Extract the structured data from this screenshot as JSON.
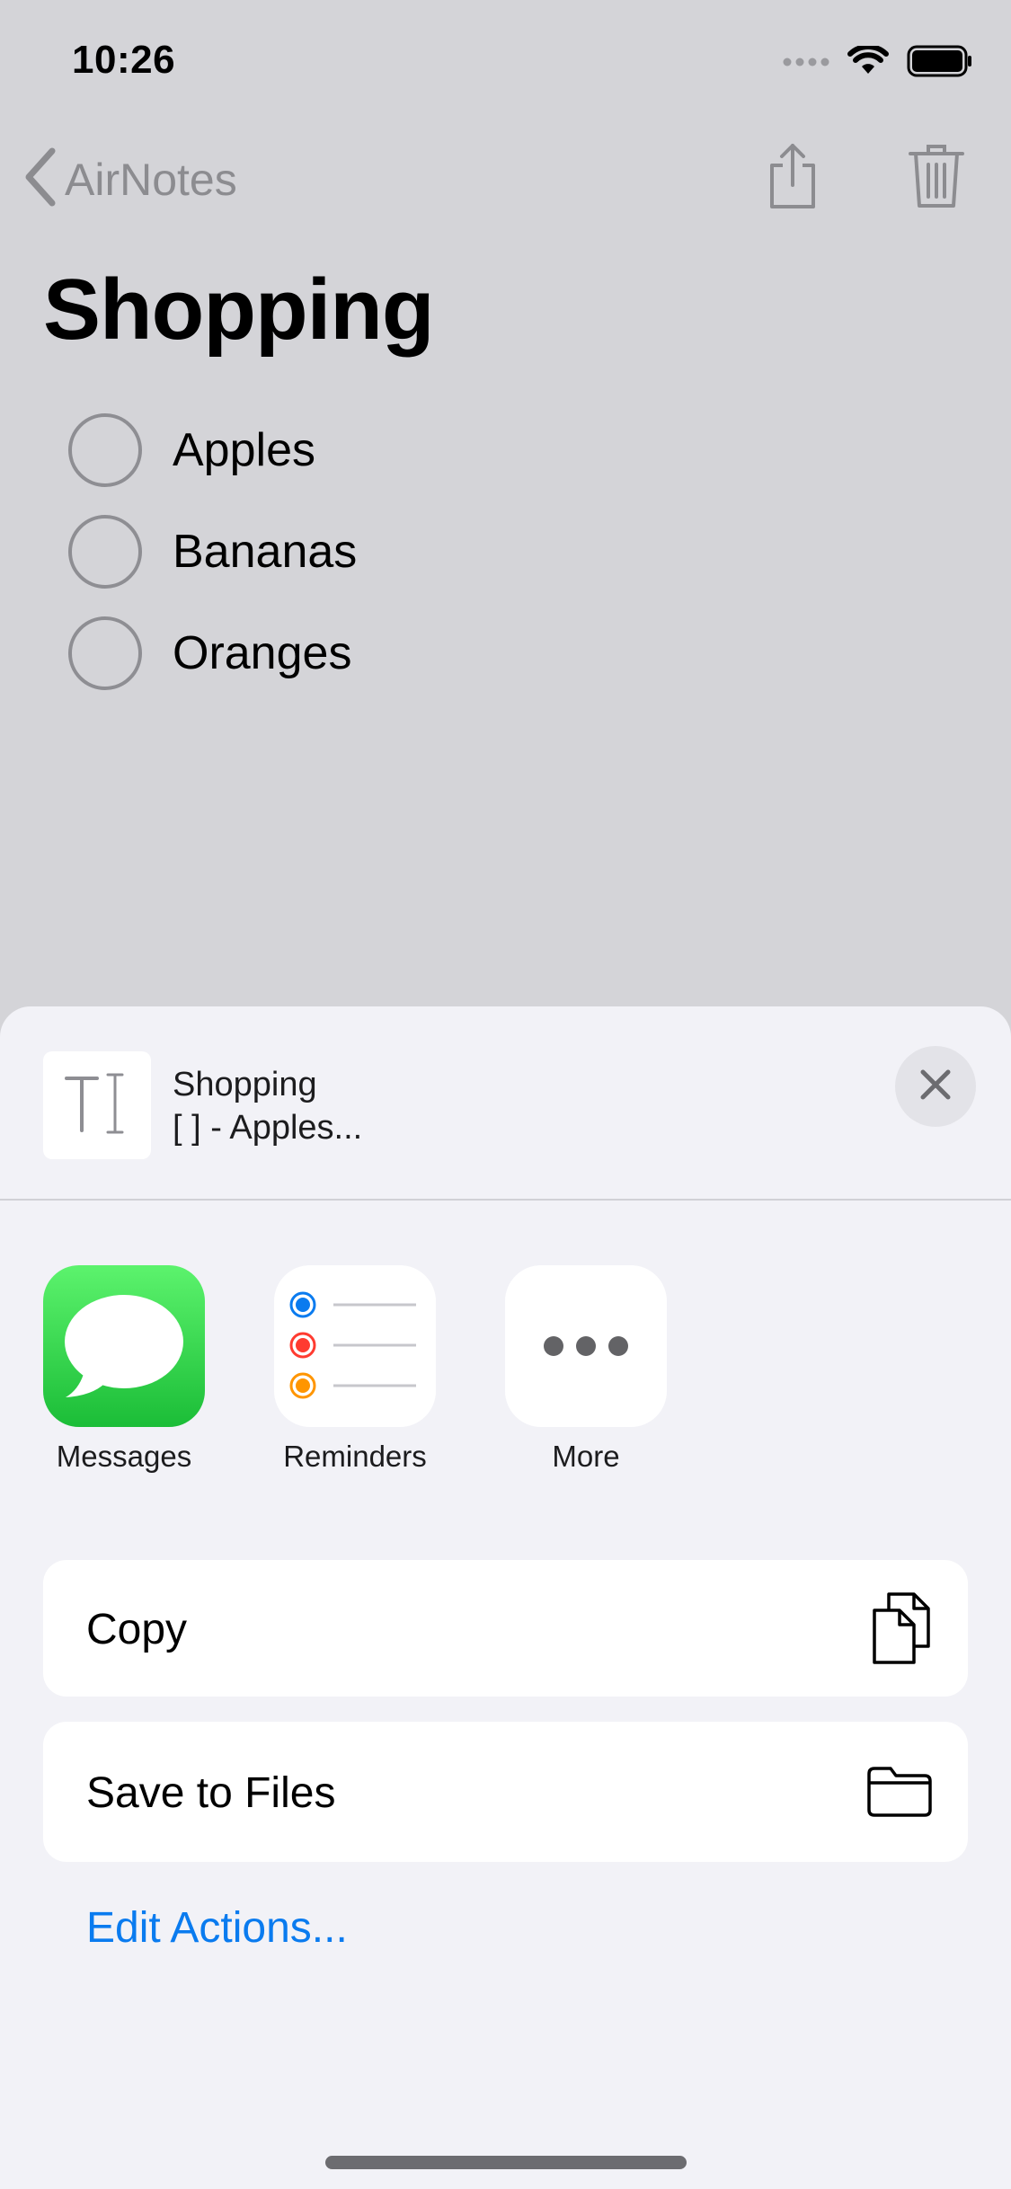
{
  "status_bar": {
    "time": "10:26"
  },
  "nav": {
    "back_label": "AirNotes"
  },
  "note": {
    "title": "Shopping",
    "items": [
      {
        "text": "Apples",
        "checked": false
      },
      {
        "text": "Bananas",
        "checked": false
      },
      {
        "text": "Oranges",
        "checked": false
      }
    ]
  },
  "share_sheet": {
    "preview_title": "Shopping",
    "preview_subtitle": "[ ] - Apples...",
    "apps": [
      {
        "label": "Messages",
        "icon": "messages-icon"
      },
      {
        "label": "Reminders",
        "icon": "reminders-icon"
      },
      {
        "label": "More",
        "icon": "more-icon"
      }
    ],
    "actions": [
      {
        "label": "Copy",
        "icon": "copy-icon"
      },
      {
        "label": "Save to Files",
        "icon": "folder-icon"
      }
    ],
    "edit_actions_label": "Edit Actions..."
  },
  "colors": {
    "accent": "#0a7bef",
    "messages_green": "#1bbd37",
    "reminder_blue": "#0a7bef",
    "reminder_red": "#ff3b30",
    "reminder_orange": "#ff9500"
  }
}
